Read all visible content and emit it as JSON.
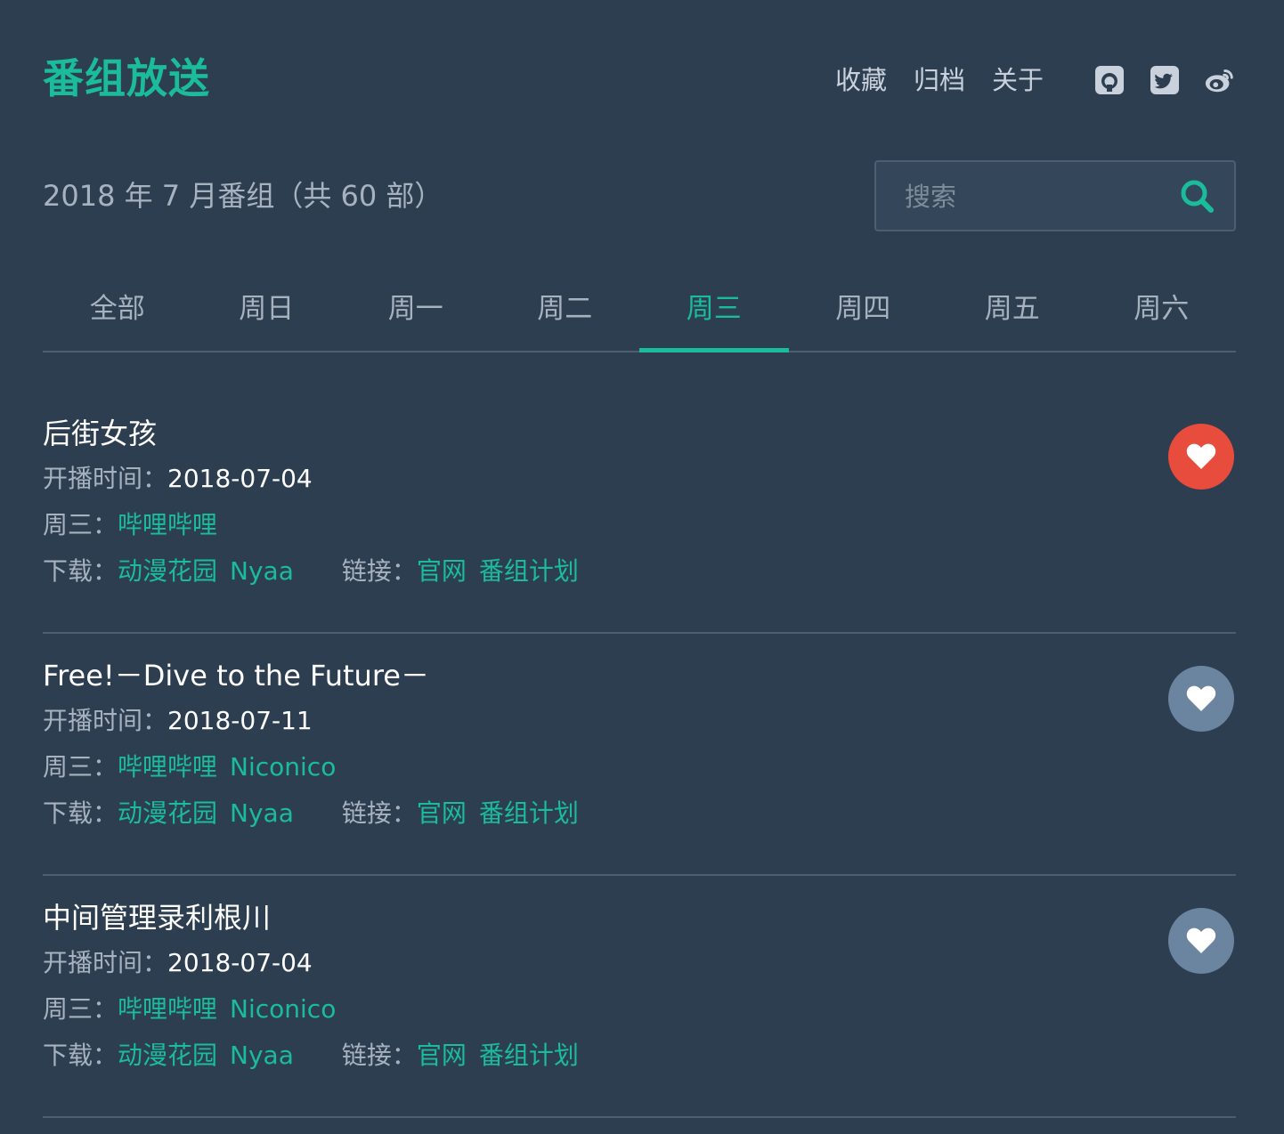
{
  "header": {
    "brand": "番组放送",
    "nav": [
      "收藏",
      "归档",
      "关于"
    ],
    "social_icons": [
      "github-icon",
      "twitter-icon",
      "weibo-icon"
    ]
  },
  "season": "2018 年 7 月番组（共 60 部）",
  "search": {
    "placeholder": "搜索"
  },
  "tabs": [
    "全部",
    "周日",
    "周一",
    "周二",
    "周三",
    "周四",
    "周五",
    "周六"
  ],
  "active_tab": "周三",
  "labels": {
    "start": "开播时间：",
    "weekday": "周三：",
    "download": "下载：",
    "links": "链接："
  },
  "items": [
    {
      "title": "后街女孩",
      "start_date": "2018-07-04",
      "platforms": [
        "哔哩哔哩"
      ],
      "downloads": [
        "动漫花园",
        "Nyaa"
      ],
      "links": [
        "官网",
        "番组计划"
      ],
      "favorited": true
    },
    {
      "title": "Free!－Dive to the Future－",
      "start_date": "2018-07-11",
      "platforms": [
        "哔哩哔哩",
        "Niconico"
      ],
      "downloads": [
        "动漫花园",
        "Nyaa"
      ],
      "links": [
        "官网",
        "番组计划"
      ],
      "favorited": false
    },
    {
      "title": "中间管理录利根川",
      "start_date": "2018-07-04",
      "platforms": [
        "哔哩哔哩",
        "Niconico"
      ],
      "downloads": [
        "动漫花园",
        "Nyaa"
      ],
      "links": [
        "官网",
        "番组计划"
      ],
      "favorited": false
    }
  ],
  "colors": {
    "background": "#2d3e50",
    "accent": "#1abc9c",
    "favorite_active": "#e74c3c",
    "favorite_inactive": "#6b84a0"
  }
}
